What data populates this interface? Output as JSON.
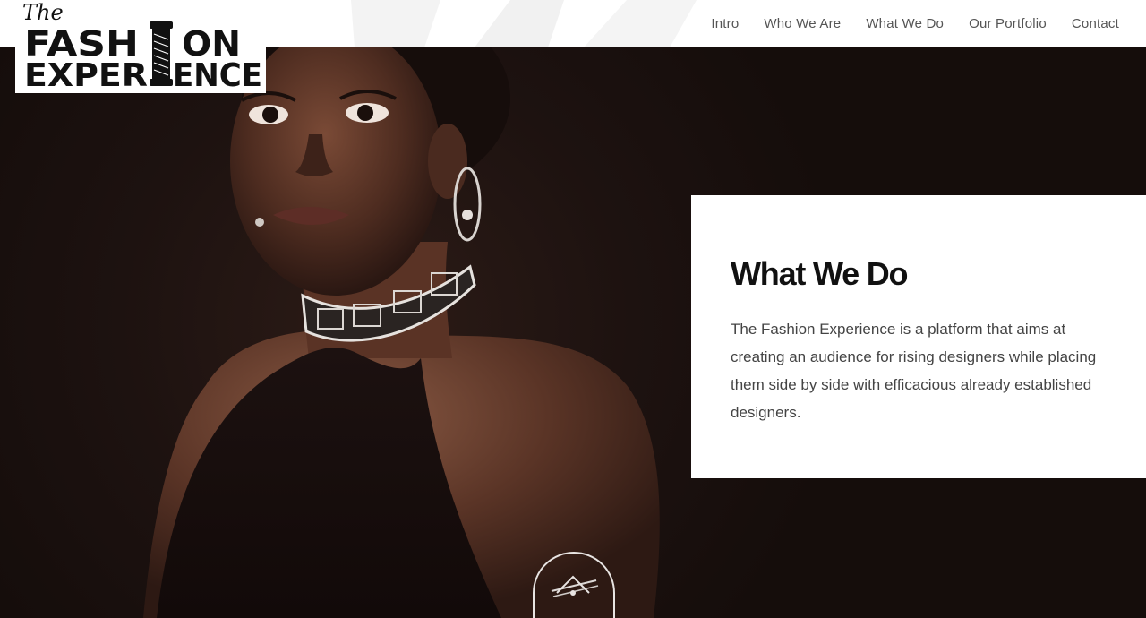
{
  "logo": {
    "script_word": "The",
    "line1_left": "FASH",
    "line1_right": "ON",
    "line2_left": "EXPER",
    "line2_right": "ENCE"
  },
  "nav": {
    "items": [
      {
        "label": "Intro"
      },
      {
        "label": "Who We Are"
      },
      {
        "label": "What We Do"
      },
      {
        "label": "Our Portfolio"
      },
      {
        "label": "Contact"
      }
    ]
  },
  "section": {
    "title": "What We Do",
    "body": "The Fashion Experience is a platform that aims at creating an audience for rising designers while placing them side by side with efficacious already established designers."
  },
  "icons": {
    "logo_spool": "thread-spool-icon",
    "scroll": "scroll-down-icon"
  },
  "colors": {
    "background": "#1a100e",
    "card": "#ffffff",
    "title": "#111111",
    "text": "#444444",
    "nav_text": "#555555"
  }
}
